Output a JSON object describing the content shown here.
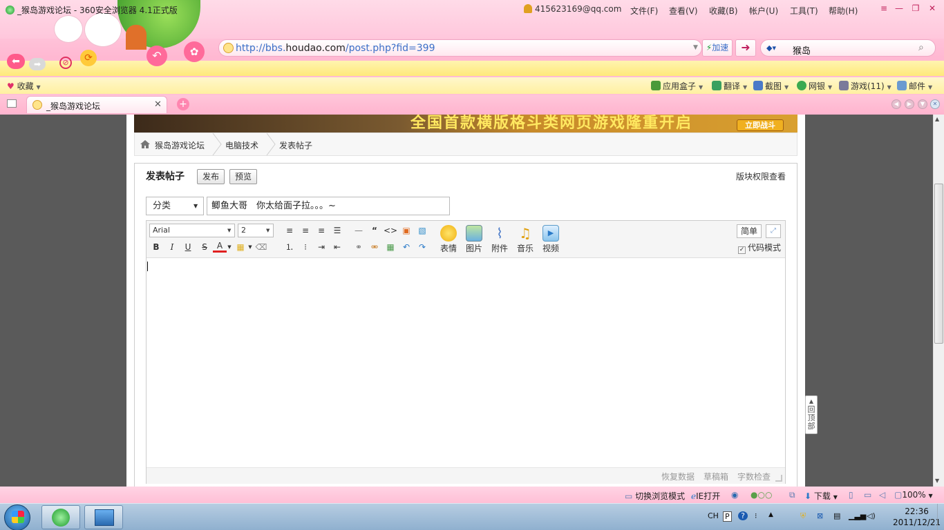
{
  "window": {
    "title": "_猴岛游戏论坛 - 360安全浏览器 4.1正式版",
    "account": "415623169@qq.com",
    "menus": [
      "文件(F)",
      "查看(V)",
      "收藏(B)",
      "帐户(U)",
      "工具(T)",
      "帮助(H)"
    ]
  },
  "address": {
    "url_prefix": "http://bbs.",
    "url_domain": "houdao.com",
    "url_path": "/post.php?fid=399",
    "speed_label": "加速",
    "search_query": "猴岛"
  },
  "bookmarks": {
    "favorites_label": "收藏",
    "tools": [
      "应用盒子",
      "翻译",
      "截图",
      "网银",
      "游戏(11)",
      "邮件"
    ]
  },
  "tabs": [
    {
      "title": "_猴岛游戏论坛"
    }
  ],
  "banner": {
    "headline": "全国首款横版格斗类网页游戏隆重开启",
    "cta": "立即战斗"
  },
  "breadcrumb": [
    "猴岛游戏论坛",
    "电脑技术",
    "发表帖子"
  ],
  "post": {
    "heading": "发表帖子",
    "publish_label": "发布",
    "preview_label": "预览",
    "permission_link": "版块权限查看",
    "category": "分类",
    "subject": "鲫鱼大哥　你太给面子拉。。。~"
  },
  "editor": {
    "font": "Arial",
    "size": "2",
    "media": [
      "表情",
      "图片",
      "附件",
      "音乐",
      "视频"
    ],
    "simple_label": "简单",
    "code_mode_label": "代码模式",
    "code_mode_checked": true,
    "footer_links": [
      "恢复数据",
      "草稿箱",
      "字数检查"
    ]
  },
  "back_to_top": "回顶部",
  "statusbar": {
    "switch_mode": "切换浏览模式",
    "ie_open": "IE打开",
    "download": "下载",
    "zoom": "100%"
  },
  "taskbar": {
    "lang": "CH",
    "time": "22:36",
    "date": "2011/12/21"
  },
  "colors": {
    "chrome_pink": "#ffc4d9",
    "link_blue": "#3a6fc8",
    "accent_magenta": "#e0306a"
  }
}
